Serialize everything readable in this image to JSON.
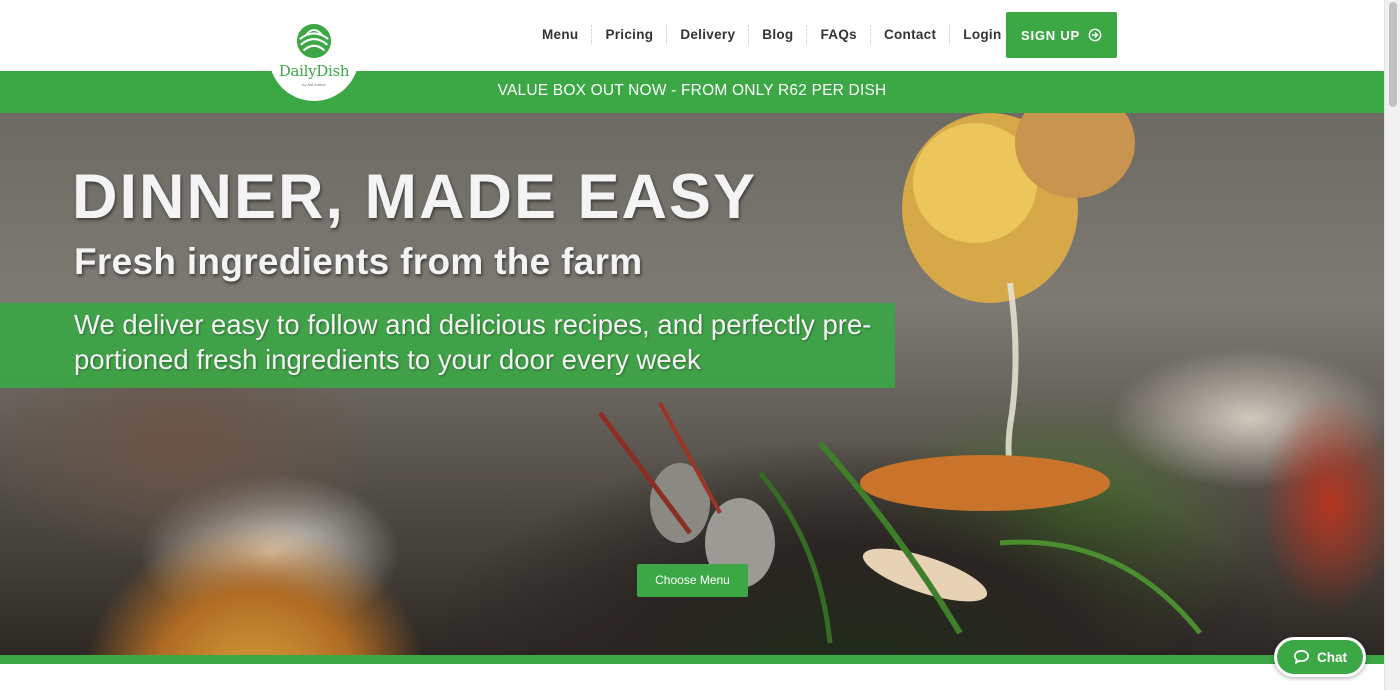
{
  "brand": {
    "name": "DailyDish",
    "tagline": "by Ant Author",
    "color": "#3ba745",
    "logo_icon": "leaf-globe-icon"
  },
  "nav": {
    "items": [
      {
        "label": "Menu"
      },
      {
        "label": "Pricing"
      },
      {
        "label": "Delivery"
      },
      {
        "label": "Blog"
      },
      {
        "label": "FAQs"
      },
      {
        "label": "Contact"
      },
      {
        "label": "Login"
      }
    ],
    "signup_label": "SIGN UP",
    "signup_icon": "arrow-circle-right-icon"
  },
  "promo": {
    "text": "VALUE BOX OUT NOW - FROM ONLY R62 PER DISH"
  },
  "hero": {
    "title": "DINNER, MADE EASY",
    "subtitle": "Fresh ingredients from the farm",
    "description": "We deliver easy to follow and delicious recipes, and perfectly pre-portioned fresh ingredients to your door every week",
    "cta_label": "Choose Menu"
  },
  "chat": {
    "label": "Chat",
    "icon": "chat-bubble-icon"
  }
}
